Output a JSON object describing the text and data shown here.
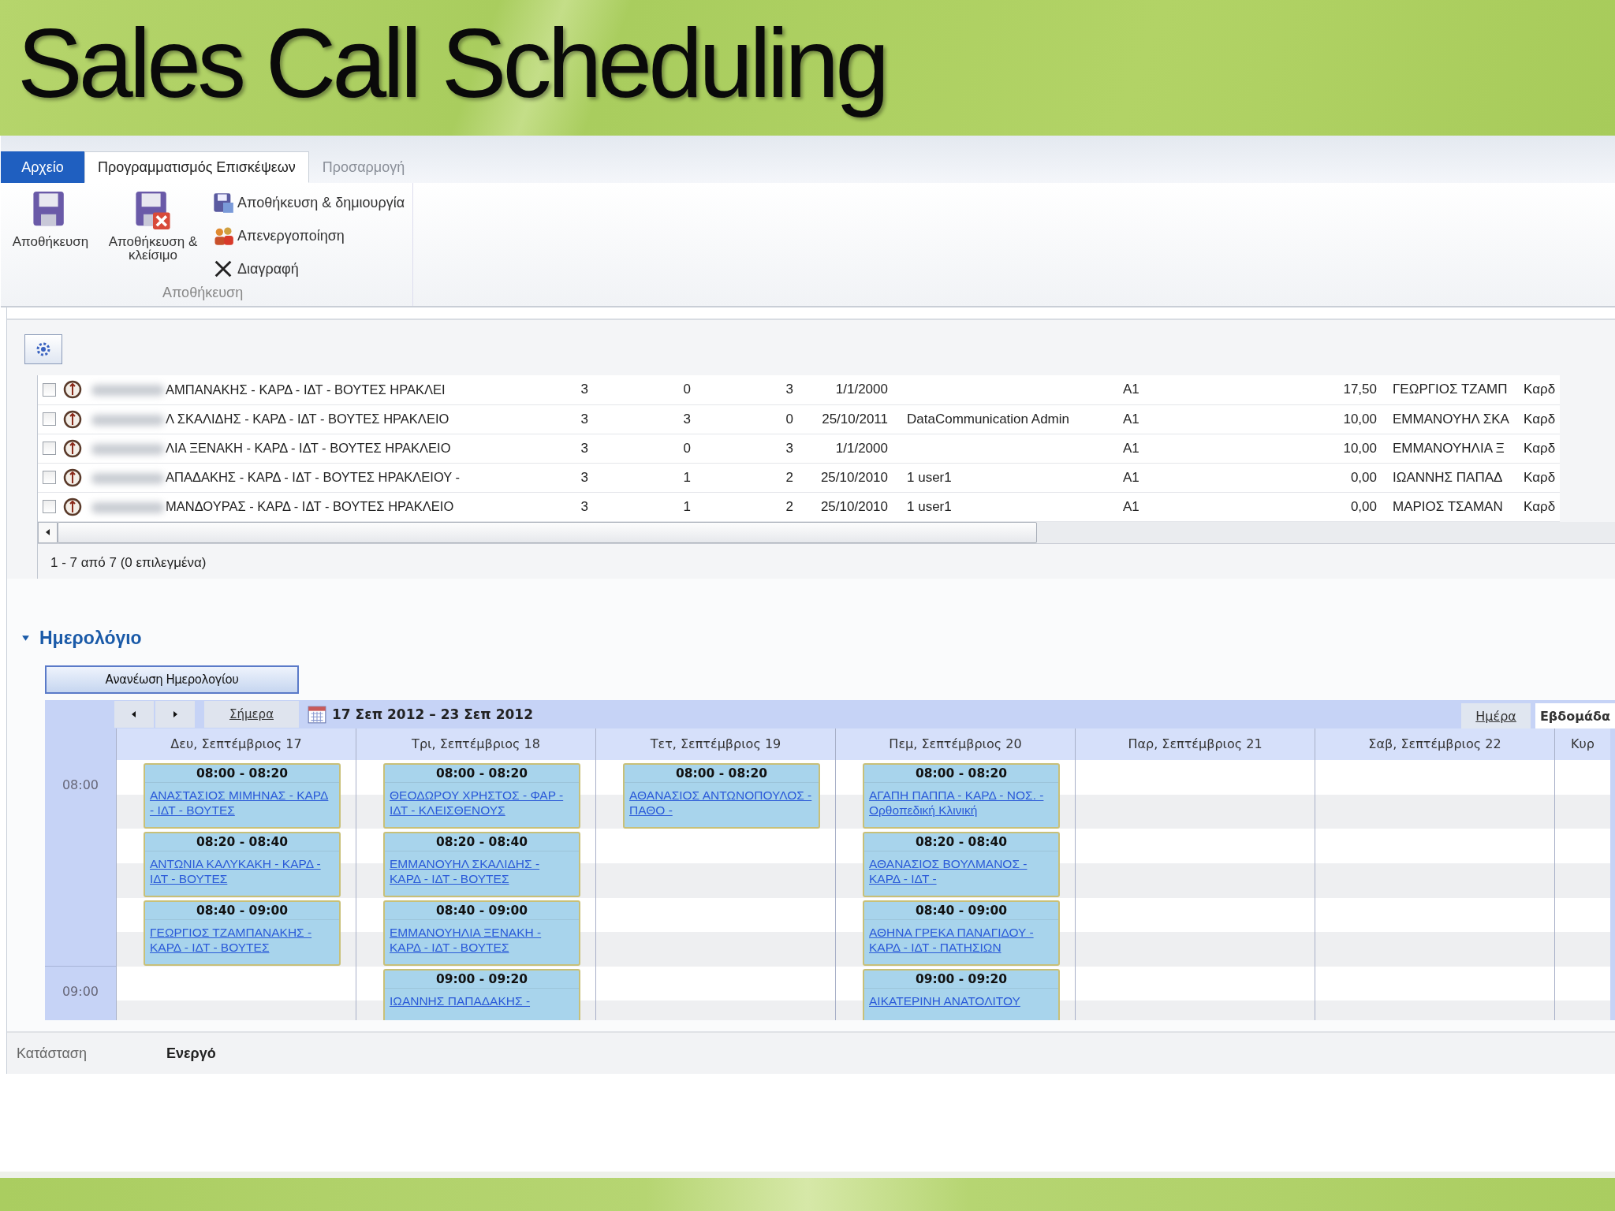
{
  "title": "Sales Call Scheduling",
  "ribbon": {
    "tabs": [
      {
        "label": "Αρχείο",
        "kind": "file",
        "selected": false
      },
      {
        "label": "Προγραμματισμός Επισκέψεων",
        "kind": "tab",
        "selected": true
      },
      {
        "label": "Προσαρμογή",
        "kind": "tab",
        "selected": false
      }
    ],
    "large_buttons": [
      {
        "label": "Αποθήκευση",
        "kind": "save"
      },
      {
        "label": "Αποθήκευση & κλείσιμο",
        "kind": "save-close"
      }
    ],
    "small_buttons": [
      {
        "label": "Αποθήκευση & δημιουργία",
        "kind": "save-new"
      },
      {
        "label": "Απενεργοποίηση",
        "kind": "deactivate"
      },
      {
        "label": "Διαγραφή",
        "kind": "delete"
      }
    ],
    "group_label": "Αποθήκευση"
  },
  "grid": {
    "rows": [
      {
        "checked": false,
        "name": "ΑΜΠΑΝΑΚΗΣ - ΚΑΡΔ - ΙΔΤ - ΒΟΥΤΕΣ ΗΡΑΚΛΕΙ",
        "column_2": "3",
        "column_3": "0",
        "column_4": "3",
        "date": "1/1/2000",
        "user": "",
        "column_7": "A1",
        "amount": "17,50",
        "contact": "ΓΕΩΡΓΙΟΣ ΤΖΑΜΠ",
        "column_10": "Καρδ"
      },
      {
        "checked": false,
        "name": "Λ ΣΚΑΛΙΔΗΣ - ΚΑΡΔ - ΙΔΤ - ΒΟΥΤΕΣ ΗΡΑΚΛΕΙΟ",
        "column_2": "3",
        "column_3": "3",
        "column_4": "0",
        "date": "25/10/2011",
        "user": "DataCommunication Admin",
        "column_7": "A1",
        "amount": "10,00",
        "contact": "ΕΜΜΑΝΟΥΗΛ ΣΚΑ",
        "column_10": "Καρδ"
      },
      {
        "checked": false,
        "name": "ΛΙΑ ΞΕΝΑΚΗ - ΚΑΡΔ - ΙΔΤ - ΒΟΥΤΕΣ ΗΡΑΚΛΕΙΟ",
        "column_2": "3",
        "column_3": "0",
        "column_4": "3",
        "date": "1/1/2000",
        "user": "",
        "column_7": "A1",
        "amount": "10,00",
        "contact": "ΕΜΜΑΝΟΥΗΛΙΑ Ξ",
        "column_10": "Καρδ"
      },
      {
        "checked": false,
        "name": "ΑΠΑΔΑΚΗΣ - ΚΑΡΔ - ΙΔΤ - ΒΟΥΤΕΣ ΗΡΑΚΛΕΙΟΥ -",
        "column_2": "3",
        "column_3": "1",
        "column_4": "2",
        "date": "25/10/2010",
        "user": "1 user1",
        "column_7": "A1",
        "amount": "0,00",
        "contact": "ΙΩΑΝΝΗΣ ΠΑΠΑΔ",
        "column_10": "Καρδ"
      },
      {
        "checked": false,
        "name": "ΜΑΝΔΟΥΡΑΣ - ΚΑΡΔ - ΙΔΤ - ΒΟΥΤΕΣ ΗΡΑΚΛΕΙΟ",
        "column_2": "3",
        "column_3": "1",
        "column_4": "2",
        "date": "25/10/2010",
        "user": "1 user1",
        "column_7": "A1",
        "amount": "0,00",
        "contact": "ΜΑΡΙΟΣ ΤΣΑΜΑΝ",
        "column_10": "Καρδ"
      }
    ],
    "footer": "1 - 7  από 7 (0 επιλεγμένα)"
  },
  "calendar": {
    "section_title": "Ημερολόγιο",
    "expanded": true,
    "refresh_button": "Ανανέωση Ημερολογίου",
    "today_link": "Σήμερα",
    "range": "17 Σεπ 2012 – 23 Σεπ 2012",
    "view_tabs": [
      {
        "label": "Ημέρα",
        "selected": false
      },
      {
        "label": "Εβδομάδα",
        "selected": true
      }
    ],
    "times": [
      "08:00",
      "09:00"
    ],
    "days": [
      {
        "label": "Δευ, Σεπτέμβριος 17",
        "events": [
          {
            "time": "08:00 - 08:20",
            "title": "ΑΝΑΣΤΑΣΙΟΣ ΜΙΜΗΝΑΣ - ΚΑΡΔ - ΙΔΤ - ΒΟΥΤΕΣ"
          },
          {
            "time": "08:20 - 08:40",
            "title": "ΑΝΤΩΝΙΑ ΚΑΛΥΚΑΚΗ - ΚΑΡΔ - ΙΔΤ - ΒΟΥΤΕΣ"
          },
          {
            "time": "08:40 - 09:00",
            "title": "ΓΕΩΡΓΙΟΣ ΤΖΑΜΠΑΝΑΚΗΣ - ΚΑΡΔ - ΙΔΤ - ΒΟΥΤΕΣ"
          }
        ]
      },
      {
        "label": "Τρι, Σεπτέμβριος 18",
        "events": [
          {
            "time": "08:00 - 08:20",
            "title": "ΘΕΟΔΩΡΟΥ ΧΡΗΣΤΟΣ - ΦΑΡ - ΙΔΤ - ΚΛΕΙΣΘΕΝΟΥΣ"
          },
          {
            "time": "08:20 - 08:40",
            "title": "ΕΜΜΑΝΟΥΗΛ ΣΚΑΛΙΔΗΣ - ΚΑΡΔ - ΙΔΤ - ΒΟΥΤΕΣ"
          },
          {
            "time": "08:40 - 09:00",
            "title": "ΕΜΜΑΝΟΥΗΛΙΑ ΞΕΝΑΚΗ - ΚΑΡΔ - ΙΔΤ - ΒΟΥΤΕΣ"
          },
          {
            "time": "09:00 - 09:20",
            "title": "ΙΩΑΝΝΗΣ ΠΑΠΑΔΑΚΗΣ -"
          }
        ]
      },
      {
        "label": "Τετ, Σεπτέμβριος 19",
        "events": [
          {
            "time": "08:00 - 08:20",
            "title": "ΑΘΑΝΑΣΙΟΣ ΑΝΤΩΝΟΠΟΥΛΟΣ - ΠΑΘΟ -"
          }
        ]
      },
      {
        "label": "Πεμ, Σεπτέμβριος 20",
        "events": [
          {
            "time": "08:00 - 08:20",
            "title": "ΑΓΑΠΗ ΠΑΠΠΑ - ΚΑΡΔ - ΝΟΣ. - Ορθοπεδική Κλινική"
          },
          {
            "time": "08:20 - 08:40",
            "title": "ΑΘΑΝΑΣΙΟΣ ΒΟΥΛΜΑΝΟΣ - ΚΑΡΔ - ΙΔΤ -"
          },
          {
            "time": "08:40 - 09:00",
            "title": "ΑΘΗΝΑ ΓΡΕΚΑ ΠΑΝΑΓΙΔΟΥ - ΚΑΡΔ - ΙΔΤ - ΠΑΤΗΣΙΩΝ"
          },
          {
            "time": "09:00 - 09:20",
            "title": "ΑΙΚΑΤΕΡΙΝΗ ΑΝΑΤΟΛΙΤΟΥ"
          }
        ]
      },
      {
        "label": "Παρ, Σεπτέμβριος 21"
      },
      {
        "label": "Σαβ, Σεπτέμβριος 22"
      },
      {
        "label": "Κυρ"
      }
    ]
  },
  "status_bar": {
    "label": "Κατάσταση",
    "value": "Ενεργό"
  }
}
